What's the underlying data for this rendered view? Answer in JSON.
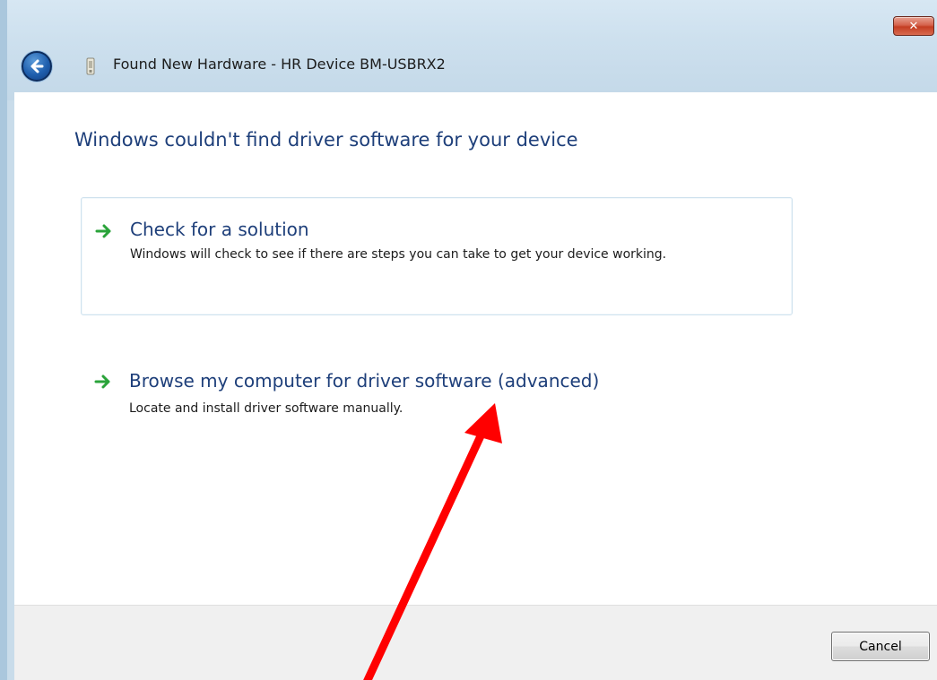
{
  "window": {
    "title_prefix": "Found New Hardware - ",
    "title_device": "HR Device BM-USBRX2",
    "close_label": "✕"
  },
  "icons": {
    "back": "back-arrow-icon",
    "device": "usb-device-icon",
    "option_arrow": "green-arrow-icon"
  },
  "main": {
    "heading": "Windows couldn't find driver software for your device",
    "options": [
      {
        "title": "Check for a solution",
        "description": "Windows will check to see if there are steps you can take to get your device working."
      },
      {
        "title": "Browse my computer for driver software (advanced)",
        "description": "Locate and install driver software manually."
      }
    ]
  },
  "footer": {
    "cancel_label": "Cancel"
  },
  "colors": {
    "heading": "#1e3f7a",
    "annotation_arrow": "#ff0000",
    "option_arrow": "#2aa33a"
  }
}
